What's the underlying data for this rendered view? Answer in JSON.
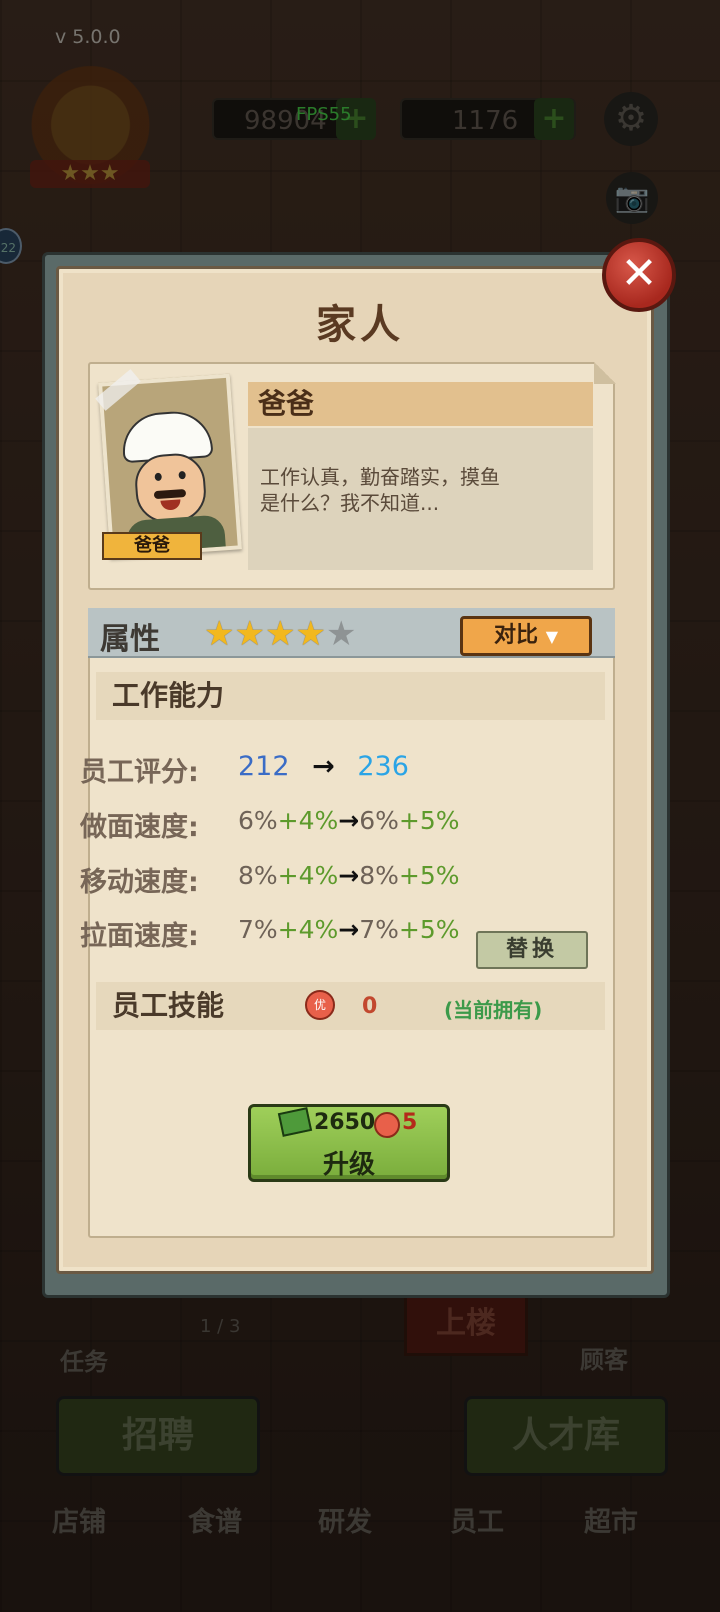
{
  "version": "v 5.0.0",
  "hud": {
    "coins": "98904",
    "gems": "1176",
    "fps": "FPS55",
    "notice_count": "22"
  },
  "background": {
    "task_label": "任务",
    "page_indicator": "1 / 3",
    "upstairs_label": "上楼",
    "customer_label": "顾客",
    "recruit_button": "招聘",
    "talent_pool_button": "人才库",
    "nav": [
      "店铺",
      "食谱",
      "研发",
      "员工",
      "超市"
    ]
  },
  "dialog": {
    "title": "家人",
    "close_icon": "close-icon",
    "character": {
      "name": "爸爸",
      "ribbon_name": "爸爸",
      "description_line1": "工作认真，勤奋踏实，摸鱼",
      "description_line2": "是什么？我不知道..."
    },
    "attributes": {
      "label": "属性",
      "stars_filled": 4,
      "stars_total": 5,
      "compare_button": "对比",
      "work_ability_title": "工作能力",
      "stats": [
        {
          "label": "员工评分:",
          "from": "212",
          "to": "236"
        },
        {
          "label": "做面速度:",
          "from_base": "6%",
          "from_plus": "+4%",
          "to_base": "6%",
          "to_plus": "+5%"
        },
        {
          "label": "移动速度:",
          "from_base": "8%",
          "from_plus": "+4%",
          "to_base": "8%",
          "to_plus": "+5%"
        },
        {
          "label": "拉面速度:",
          "from_base": "7%",
          "from_plus": "+4%",
          "to_base": "7%",
          "to_plus": "+5%"
        }
      ],
      "arrow": "→",
      "replace_button": "替换",
      "skills_title": "员工技能",
      "skill_icon_text": "优",
      "skill_count": "0",
      "skill_owned": "(当前拥有)"
    },
    "upgrade": {
      "cost": "2650",
      "medal_cost": "5",
      "label": "升级"
    }
  }
}
